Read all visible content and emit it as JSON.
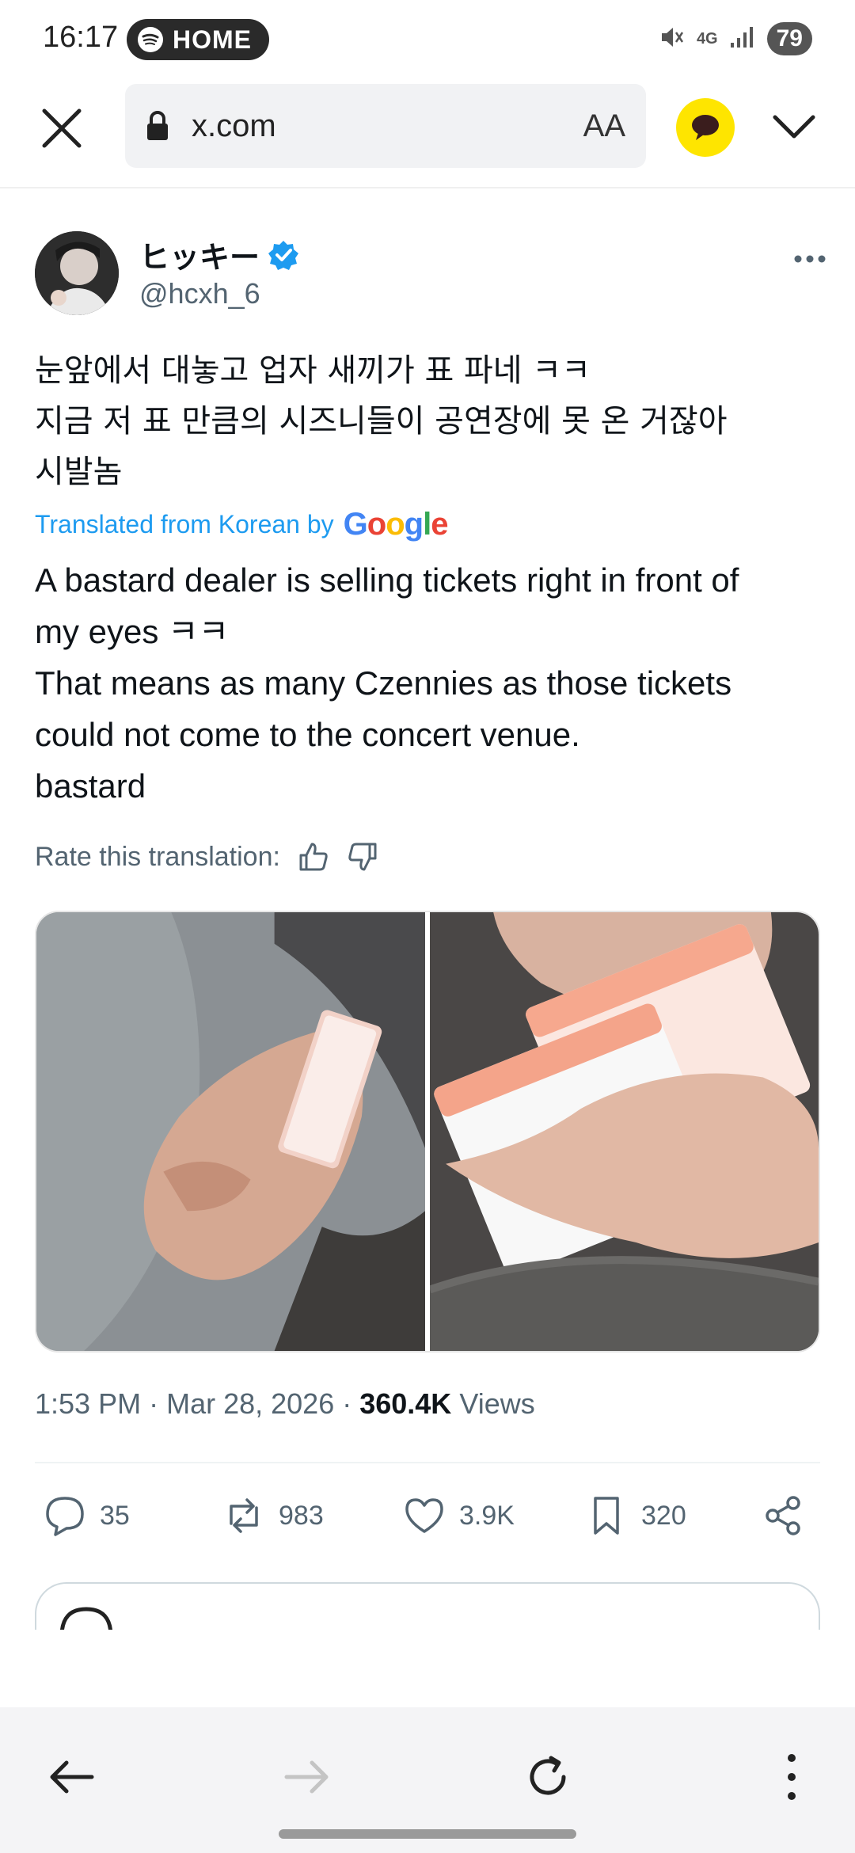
{
  "status_bar": {
    "time": "16:17",
    "media_label": "HOME",
    "network": "4G",
    "battery": "79"
  },
  "browser": {
    "url": "x.com",
    "text_size_label": "AA"
  },
  "tweet": {
    "display_name": "ヒッキー",
    "handle": "@hcxh_6",
    "original_text": [
      "눈앞에서 대놓고 업자 새끼가 표 파네 ㅋㅋ",
      "지금 저 표 만큼의 시즈니들이 공연장에 못 온 거잖아",
      "시발놈"
    ],
    "translated_label": "Translated from Korean by",
    "translation_provider": "Google",
    "translated_text": [
      "A bastard dealer is selling tickets right in front of",
      "my eyes ㅋㅋ",
      "That means as many Czennies as those tickets",
      "could not come to the concert venue.",
      "bastard"
    ],
    "rate_label": "Rate this translation:",
    "time": "1:53 PM",
    "date": "Mar 28, 2026",
    "views_count": "360.4K",
    "views_label": "Views",
    "actions": {
      "replies": "35",
      "reposts": "983",
      "likes": "3.9K",
      "bookmarks": "320"
    }
  },
  "colors": {
    "accent": "#1d9bf0",
    "muted": "#536471",
    "kakao": "#fee500"
  },
  "icons": [
    "close-icon",
    "lock-icon",
    "kakao-talk-icon",
    "chevron-down-icon",
    "verified-badge-icon",
    "more-icon",
    "thumbs-up-icon",
    "thumbs-down-icon",
    "reply-icon",
    "repost-icon",
    "like-icon",
    "bookmark-icon",
    "share-icon",
    "back-arrow-icon",
    "forward-arrow-icon",
    "reload-icon",
    "menu-dots-icon"
  ]
}
